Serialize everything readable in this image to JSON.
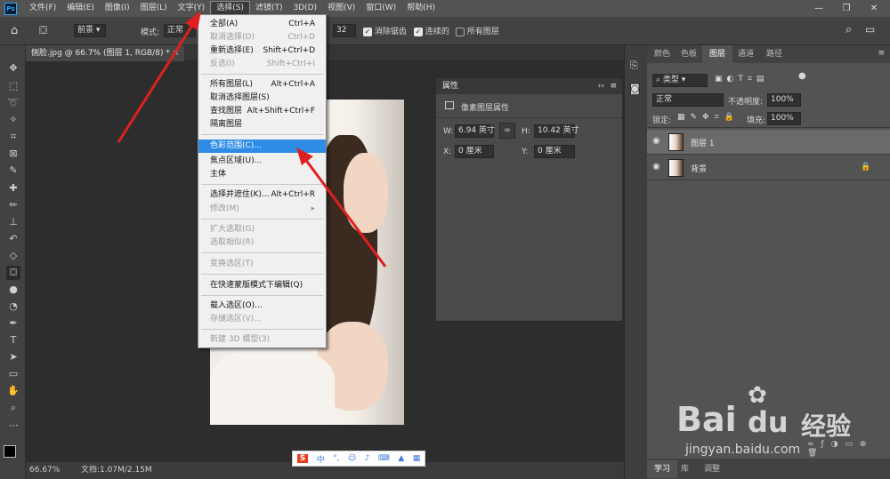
{
  "menubar": {
    "logo": "Ps",
    "items": [
      "文件(F)",
      "编辑(E)",
      "图像(I)",
      "图层(L)",
      "文字(Y)",
      "选择(S)",
      "滤镜(T)",
      "3D(D)",
      "视图(V)",
      "窗口(W)",
      "帮助(H)"
    ],
    "min": "—",
    "restore": "❐",
    "close": "✕"
  },
  "options": {
    "preset": "前景",
    "mode_label": "模式:",
    "mode": "正常",
    "tolerance": "32",
    "antialias": "消除锯齿",
    "contiguous": "连续的",
    "all_layers": "所有图层"
  },
  "document": {
    "tab": "侧脸.jpg @ 66.7% (图层 1, RGB/8) *",
    "close": "×",
    "zoom": "66.67%",
    "docinfo": "文档:1.07M/2.15M"
  },
  "select_menu": [
    {
      "label": "全部(A)",
      "shortcut": "Ctrl+A",
      "enabled": true
    },
    {
      "label": "取消选择(D)",
      "shortcut": "Ctrl+D",
      "enabled": false
    },
    {
      "label": "重新选择(E)",
      "shortcut": "Shift+Ctrl+D",
      "enabled": true
    },
    {
      "label": "反选(I)",
      "shortcut": "Shift+Ctrl+I",
      "enabled": false
    },
    {
      "label": "所有图层(L)",
      "shortcut": "Alt+Ctrl+A",
      "enabled": true
    },
    {
      "label": "取消选择图层(S)",
      "shortcut": "",
      "enabled": true
    },
    {
      "label": "查找图层",
      "shortcut": "Alt+Shift+Ctrl+F",
      "enabled": true
    },
    {
      "label": "隔离图层",
      "shortcut": "",
      "enabled": true
    },
    {
      "label": "色彩范围(C)...",
      "shortcut": "",
      "enabled": true,
      "highlighted": true
    },
    {
      "label": "焦点区域(U)...",
      "shortcut": "",
      "enabled": true
    },
    {
      "label": "主体",
      "shortcut": "",
      "enabled": true
    },
    {
      "label": "选择并遮住(K)...",
      "shortcut": "Alt+Ctrl+R",
      "enabled": true
    },
    {
      "label": "修改(M)",
      "shortcut": "▸",
      "enabled": false
    },
    {
      "label": "扩大选取(G)",
      "shortcut": "",
      "enabled": false
    },
    {
      "label": "选取相似(R)",
      "shortcut": "",
      "enabled": false
    },
    {
      "label": "变换选区(T)",
      "shortcut": "",
      "enabled": false
    },
    {
      "label": "在快速蒙版模式下编辑(Q)",
      "shortcut": "",
      "enabled": true
    },
    {
      "label": "载入选区(O)...",
      "shortcut": "",
      "enabled": true
    },
    {
      "label": "存储选区(V)...",
      "shortcut": "",
      "enabled": false
    },
    {
      "label": "新建 3D 模型(3)",
      "shortcut": "",
      "enabled": false
    }
  ],
  "properties": {
    "title": "属性",
    "section": "像素图层属性",
    "w_label": "W:",
    "w": "6.94 英寸",
    "h_label": "H:",
    "h": "10.42 英寸",
    "x_label": "X:",
    "x": "0 厘米",
    "y_label": "Y:",
    "y": "0 厘米"
  },
  "layers_panel": {
    "tabs": [
      "颜色",
      "色板",
      "图层",
      "通道",
      "路径"
    ],
    "filter": "类型",
    "blend": "正常",
    "opacity_label": "不透明度:",
    "opacity": "100%",
    "lock_label": "锁定:",
    "fill_label": "填充:",
    "fill": "100%",
    "layers": [
      {
        "name": "图层 1"
      },
      {
        "name": "背景"
      }
    ],
    "bottom_tabs": [
      "学习",
      "库",
      "调整"
    ]
  },
  "ime": {
    "label": "中"
  },
  "watermark": {
    "brand": "Bai",
    "cn": "经验",
    "url": "jingyan.baidu.com"
  }
}
